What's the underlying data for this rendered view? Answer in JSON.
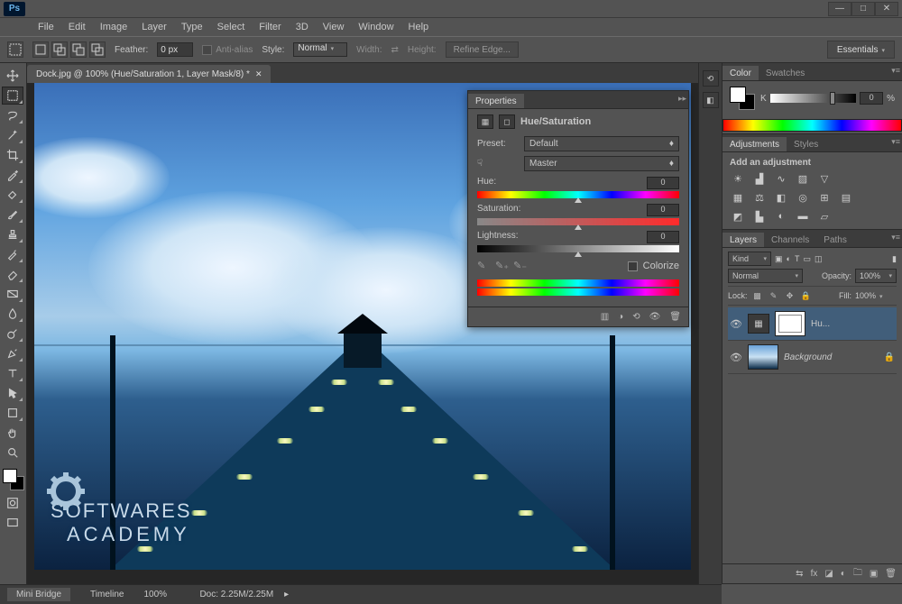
{
  "app": {
    "logo": "Ps"
  },
  "window": {
    "min": "—",
    "max": "□",
    "close": "✕"
  },
  "menu": [
    "File",
    "Edit",
    "Image",
    "Layer",
    "Type",
    "Select",
    "Filter",
    "3D",
    "View",
    "Window",
    "Help"
  ],
  "options": {
    "feather_label": "Feather:",
    "feather_value": "0 px",
    "antialias": "Anti-alias",
    "style_label": "Style:",
    "style_value": "Normal",
    "width_label": "Width:",
    "height_label": "Height:",
    "refine": "Refine Edge...",
    "workspace": "Essentials"
  },
  "document": {
    "tab": "Dock.jpg @ 100% (Hue/Saturation 1, Layer Mask/8) *"
  },
  "watermark": {
    "l1": "SOFTWARES",
    "l2": "ACADEMY"
  },
  "color_panel": {
    "tabs": [
      "Color",
      "Swatches"
    ],
    "channel": "K",
    "value": "0",
    "unit": "%"
  },
  "adjustments_panel": {
    "tabs": [
      "Adjustments",
      "Styles"
    ],
    "title": "Add an adjustment"
  },
  "layers_panel": {
    "tabs": [
      "Layers",
      "Channels",
      "Paths"
    ],
    "filter": "Kind",
    "blend_mode": "Normal",
    "opacity_label": "Opacity:",
    "opacity_value": "100%",
    "lock_label": "Lock:",
    "fill_label": "Fill:",
    "fill_value": "100%",
    "layers": [
      {
        "name": "Hu...",
        "type": "adjustment"
      },
      {
        "name": "Background",
        "type": "image",
        "locked": true
      }
    ]
  },
  "properties": {
    "title": "Properties",
    "adjustment": "Hue/Saturation",
    "preset_label": "Preset:",
    "preset_value": "Default",
    "channel_value": "Master",
    "hue_label": "Hue:",
    "hue_value": "0",
    "sat_label": "Saturation:",
    "sat_value": "0",
    "lig_label": "Lightness:",
    "lig_value": "0",
    "colorize": "Colorize"
  },
  "status": {
    "minibr": "Mini Bridge",
    "timeline": "Timeline",
    "zoom": "100%",
    "doc": "Doc: 2.25M/2.25M"
  }
}
